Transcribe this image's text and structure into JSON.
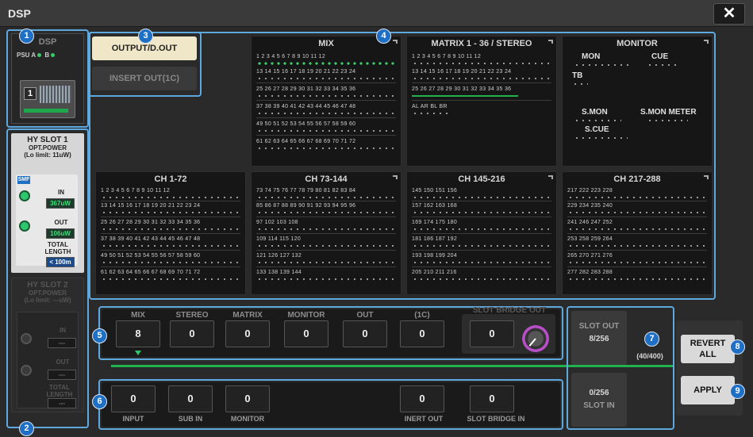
{
  "window": {
    "title": "DSP",
    "close": "✕"
  },
  "callouts": [
    "1",
    "2",
    "3",
    "4",
    "5",
    "6",
    "7",
    "8",
    "9"
  ],
  "dsp": {
    "title": "DSP",
    "psu": "PSU",
    "psu_a": "A",
    "psu_b": "B",
    "unit_number": "1"
  },
  "slot1": {
    "title": "HY SLOT 1",
    "opt_power": "OPT.POWER",
    "limit": "(Lo limit: 11uW)",
    "smf": "SMF",
    "in_label": "IN",
    "in_value": "367uW",
    "out_label": "OUT",
    "out_value": "106uW",
    "total_label": "TOTAL",
    "length_label": "LENGTH",
    "length_value": "< 100m"
  },
  "slot2": {
    "title": "HY SLOT 2",
    "opt_power": "OPT.POWER",
    "limit": "(Lo limit: ---uW)",
    "in_label": "IN",
    "in_value": "---",
    "out_label": "OUT",
    "out_value": "---",
    "total_label": "TOTAL",
    "length_label": "LENGTH",
    "length_value": "---"
  },
  "tabs": {
    "output": "OUTPUT/D.OUT",
    "insert": "INSERT OUT(1C)"
  },
  "modules": {
    "mix": {
      "title": "MIX",
      "rows": [
        "1  2  3  4  5  6  7  8  9  10 11 12",
        "13 14 15 16 17 18  19 20 21 22 23 24",
        "25 26 27 28 29 30  31 32 33 34 35 36",
        "37 38 39 40 41 42  43 44 45 46 47 48",
        "49 50 51 52 53 54  55 56 57 58 59 60",
        "61 62 63 64 65 66  67 68 69 70 71 72"
      ]
    },
    "matrix": {
      "title": "MATRIX 1 - 36 / STEREO",
      "rows": [
        "1  2  3  4  5  6  7  8  9  10 11 12",
        "13 14 15 16 17 18  19 20 21 22 23 24",
        "25 26 27 28 29 30  31 32 33 34 35 36",
        "AL AR BL BR"
      ]
    },
    "monitor": {
      "title": "MONITOR",
      "mon": "MON",
      "cue": "CUE",
      "tb": "TB",
      "smon": "S.MON",
      "smon_meter": "S.MON METER",
      "scue": "S.CUE"
    },
    "ch1": {
      "title": "CH 1-72",
      "rows": [
        "1  2  3  4  5  6  7  8  9  10 11 12",
        "13 14 15 16 17 18  19 20 21 22 23 24",
        "25 26 27 28 29 30  31 32 33 34 35 36",
        "37 38 39 40 41 42  43 44 45 46 47 48",
        "49 50 51 52 53 54  55 56 57 58 59 60",
        "61 62 63 64 65 66  67 68 69 70 71 72"
      ]
    },
    "ch2": {
      "title": "CH 73-144",
      "rows": [
        "73 74 75 76 77 78  79 80 81 82 83 84",
        "85 86 87 88 89 90  91 92 93 94 95 96",
        "97                102 103                108",
        "109               114 115               120",
        "121               126 127               132",
        "133               138 139               144"
      ]
    },
    "ch3": {
      "title": "CH 145-216",
      "rows": [
        "145               150 151               156",
        "157               162 163               168",
        "169               174 175               180",
        "181               186 187               192",
        "193               198 199               204",
        "205               210 211               216"
      ]
    },
    "ch4": {
      "title": "CH 217-288",
      "rows": [
        "217               222 223               228",
        "229               234 235               240",
        "241               246 247               252",
        "253               258 259               264",
        "265               270 271               276",
        "277               282 283               288"
      ]
    }
  },
  "buses_out": [
    {
      "label": "MIX",
      "value": "8"
    },
    {
      "label": "STEREO",
      "value": "0"
    },
    {
      "label": "MATRIX",
      "value": "0"
    },
    {
      "label": "MONITOR",
      "value": "0"
    },
    {
      "label": "OUT",
      "value": "0"
    },
    {
      "label": "(1C)",
      "value": "0"
    }
  ],
  "slot_bridge_out": {
    "label": "SLOT BRIDGE OUT",
    "value": "0"
  },
  "buses_in": [
    {
      "label": "INPUT",
      "value": "0"
    },
    {
      "label": "SUB IN",
      "value": "0"
    },
    {
      "label": "MONITOR",
      "value": "0"
    },
    {
      "label": "INERT OUT",
      "value": "0"
    },
    {
      "label": "SLOT BRIDGE IN",
      "value": "0"
    }
  ],
  "slot_counts": {
    "out_label": "SLOT OUT",
    "out_value": "8/256",
    "total": "(40/400)",
    "in_value": "0/256",
    "in_label": "SLOT IN"
  },
  "buttons": {
    "revert": "REVERT ALL",
    "apply": "APPLY"
  },
  "colors": {
    "accent": "#5ea8e0",
    "callout": "#1f6fc4",
    "led_green": "#38d26a",
    "knob": "#b84fc8"
  }
}
